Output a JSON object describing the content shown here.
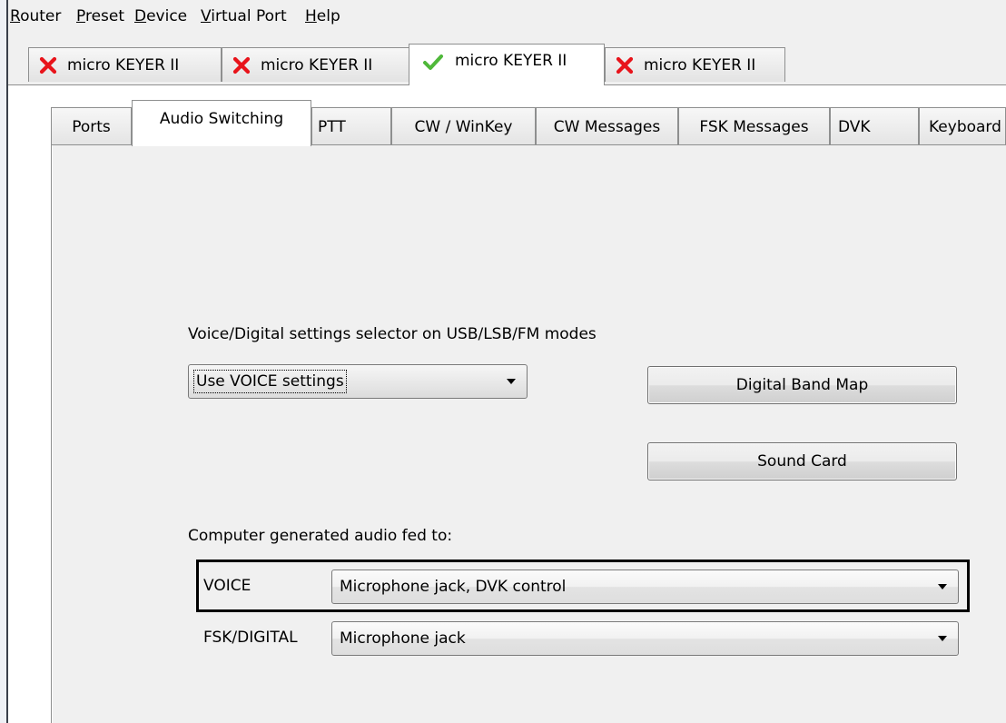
{
  "menu": {
    "items": [
      {
        "label": "Router",
        "accel": "R",
        "rest": "outer"
      },
      {
        "label": "Preset",
        "accel": "P",
        "rest": "reset"
      },
      {
        "label": "Device",
        "accel": "D",
        "rest": "evice"
      },
      {
        "label": "Virtual Port",
        "accel": "V",
        "rest": "irtual Port"
      },
      {
        "label": "Help",
        "accel": "H",
        "rest": "elp"
      }
    ]
  },
  "device_tabs": [
    {
      "label": "micro KEYER II",
      "status": "x-icon",
      "active": false
    },
    {
      "label": "micro KEYER II",
      "status": "x-icon",
      "active": false
    },
    {
      "label": "micro KEYER II",
      "status": "check-icon",
      "active": true
    },
    {
      "label": "micro KEYER II",
      "status": "x-icon",
      "active": false
    }
  ],
  "inner_tabs": [
    {
      "label": "Ports"
    },
    {
      "label": "Audio Switching",
      "active": true
    },
    {
      "label": "PTT"
    },
    {
      "label": "CW / WinKey"
    },
    {
      "label": "CW Messages"
    },
    {
      "label": "FSK Messages"
    },
    {
      "label": "DVK"
    },
    {
      "label": "Keyboard"
    }
  ],
  "audio": {
    "selector_label": "Voice/Digital settings selector on USB/LSB/FM modes",
    "selector_value": "Use VOICE settings",
    "digital_band_map_button": "Digital Band Map",
    "sound_card_button": "Sound Card",
    "fed_to_label": "Computer generated audio fed to:",
    "voice_label": "VOICE",
    "voice_value": "Microphone jack, DVK control",
    "fsk_label": "FSK/DIGITAL",
    "fsk_value": "Microphone jack"
  },
  "colors": {
    "x_icon": "#e8141b",
    "check_icon": "#4fb83a",
    "panel_bg": "#f0f0f0",
    "tab_border": "#8e8f8f"
  }
}
